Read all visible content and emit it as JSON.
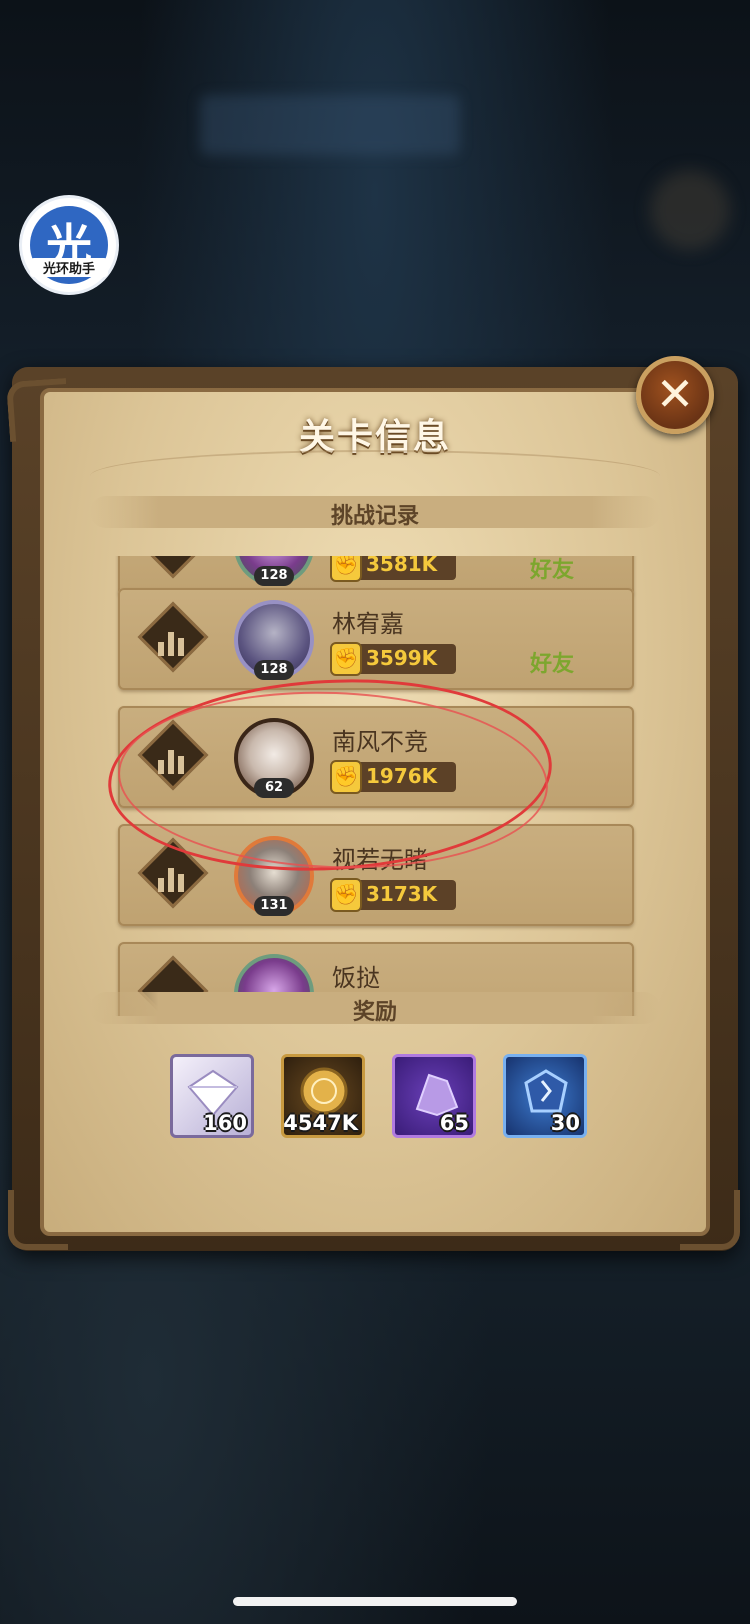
{
  "watermark": {
    "glyph": "光",
    "label": "光环助手"
  },
  "dialog": {
    "title": "关卡信息",
    "close_icon": "close-icon"
  },
  "records": {
    "section_title": "挑战记录",
    "rows": [
      {
        "name": "",
        "level": "128",
        "power": "3581K",
        "tag": "好友"
      },
      {
        "name": "林宥嘉",
        "level": "128",
        "power": "3599K",
        "tag": "好友"
      },
      {
        "name": "南风不竞",
        "level": "62",
        "power": "1976K",
        "tag": ""
      },
      {
        "name": "视若无睹",
        "level": "131",
        "power": "3173K",
        "tag": ""
      },
      {
        "name": "饭挞",
        "level": "",
        "power": "",
        "tag": ""
      }
    ]
  },
  "rewards": {
    "section_title": "奖励",
    "items": [
      {
        "icon": "diamond-icon",
        "quantity": "160"
      },
      {
        "icon": "gold-coin-icon",
        "quantity": "4547K"
      },
      {
        "icon": "hero-dust-icon",
        "quantity": "65"
      },
      {
        "icon": "crystal-shard-icon",
        "quantity": "30"
      }
    ]
  },
  "colors": {
    "annotation": "#e03a3a",
    "friend_tag": "#7da62e",
    "power_text": "#f5c93c"
  }
}
